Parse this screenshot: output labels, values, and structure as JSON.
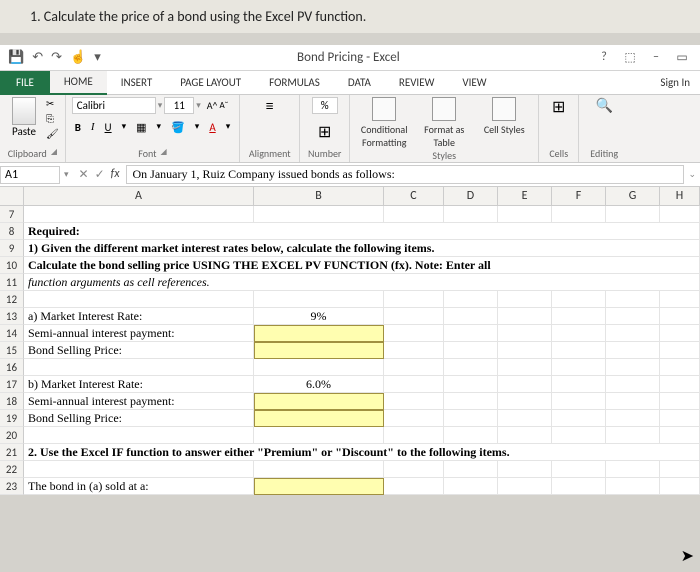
{
  "question": "1. Calculate the price of a bond using the Excel PV function.",
  "title_bar": {
    "app_title": "Bond Pricing - Excel"
  },
  "win_controls": {
    "help": "?",
    "opts": "⬚",
    "min": "–",
    "max": "▭"
  },
  "ribbon": {
    "file": "FILE",
    "tabs": [
      "HOME",
      "INSERT",
      "PAGE LAYOUT",
      "FORMULAS",
      "DATA",
      "REVIEW",
      "VIEW"
    ],
    "sign_in": "Sign In",
    "clipboard": {
      "paste": "Paste",
      "label": "Clipboard"
    },
    "font": {
      "name": "Calibri",
      "size": "11",
      "label": "Font"
    },
    "alignment": {
      "label": "Alignment"
    },
    "number": {
      "percent": "%",
      "label": "Number"
    },
    "styles": {
      "cond": "Conditional Formatting",
      "fat": "Format as Table",
      "cellstyles": "Cell Styles",
      "label": "Styles"
    },
    "cells": {
      "label": "Cells"
    },
    "editing": {
      "label": "Editing"
    }
  },
  "formula_bar": {
    "name_box": "A1",
    "content": "On January 1, Ruiz Company issued bonds as follows:"
  },
  "columns": [
    "",
    "A",
    "B",
    "C",
    "D",
    "E",
    "F",
    "G",
    "H"
  ],
  "rows": {
    "r7": "7",
    "r8": "8",
    "r9": "9",
    "r10": "10",
    "r11": "11",
    "r12": "12",
    "r13": "13",
    "r14": "14",
    "r15": "15",
    "r16": "16",
    "r17": "17",
    "r18": "18",
    "r19": "19",
    "r20": "20",
    "r21": "21",
    "r22": "22",
    "r23": "23"
  },
  "cells": {
    "a8": "Required:",
    "a9": "1) Given the different market interest rates below, calculate the following items.",
    "a10": "Calculate the bond selling price USING THE EXCEL PV FUNCTION (fx). Note: Enter all",
    "a11": "function arguments as cell references.",
    "a13": "a) Market Interest Rate:",
    "b13": "9%",
    "a14": "    Semi-annual interest payment:",
    "a15": "    Bond Selling Price:",
    "a17": "b) Market Interest Rate:",
    "b17": "6.0%",
    "a18": "    Semi-annual interest payment:",
    "a19": "    Bond Selling Price:",
    "a21": "2. Use the Excel IF function to answer either \"Premium\" or \"Discount\" to the following items.",
    "a23": "The bond in (a) sold at a:"
  }
}
